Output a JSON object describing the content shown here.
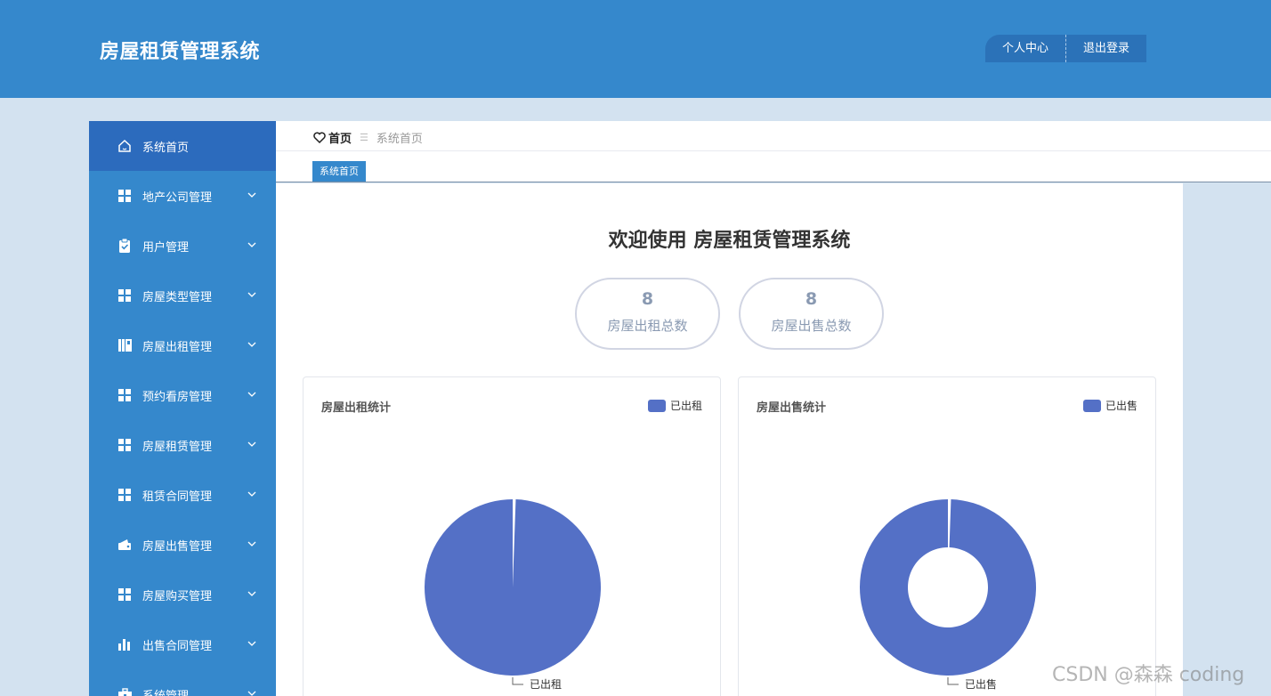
{
  "app": {
    "title": "房屋租赁管理系统"
  },
  "header": {
    "profile_label": "个人中心",
    "logout_label": "退出登录"
  },
  "sidebar": {
    "items": [
      {
        "label": "系统首页",
        "icon": "home-icon",
        "active": true
      },
      {
        "label": "地产公司管理",
        "icon": "grid-icon"
      },
      {
        "label": "用户管理",
        "icon": "clipboard-icon"
      },
      {
        "label": "房屋类型管理",
        "icon": "grid-icon"
      },
      {
        "label": "房屋出租管理",
        "icon": "book-icon"
      },
      {
        "label": "预约看房管理",
        "icon": "grid-icon"
      },
      {
        "label": "房屋租赁管理",
        "icon": "grid-icon"
      },
      {
        "label": "租赁合同管理",
        "icon": "grid-icon"
      },
      {
        "label": "房屋出售管理",
        "icon": "wallet-icon"
      },
      {
        "label": "房屋购买管理",
        "icon": "grid-icon"
      },
      {
        "label": "出售合同管理",
        "icon": "bar-chart-icon"
      },
      {
        "label": "系统管理",
        "icon": "toolbox-icon"
      }
    ]
  },
  "breadcrumb": {
    "home": "首页",
    "current": "系统首页"
  },
  "tabs": [
    {
      "label": "系统首页"
    }
  ],
  "main": {
    "welcome": "欢迎使用 房屋租赁管理系统",
    "stats": [
      {
        "value": "8",
        "label": "房屋出租总数"
      },
      {
        "value": "8",
        "label": "房屋出售总数"
      }
    ]
  },
  "colors": {
    "header": "#3588cc",
    "sidebar_active": "#2c6bbd",
    "series": "#5470c6"
  },
  "chart_data": [
    {
      "type": "pie",
      "title": "房屋出租统计",
      "legend": [
        "已出租"
      ],
      "legend_position": "top-right",
      "slices": [
        {
          "name": "已出租",
          "value": 8
        }
      ],
      "donut": false
    },
    {
      "type": "pie",
      "title": "房屋出售统计",
      "legend": [
        "已出售"
      ],
      "legend_position": "top-right",
      "slices": [
        {
          "name": "已出售",
          "value": 8
        }
      ],
      "donut": true
    }
  ],
  "watermark": "CSDN @森森 coding"
}
